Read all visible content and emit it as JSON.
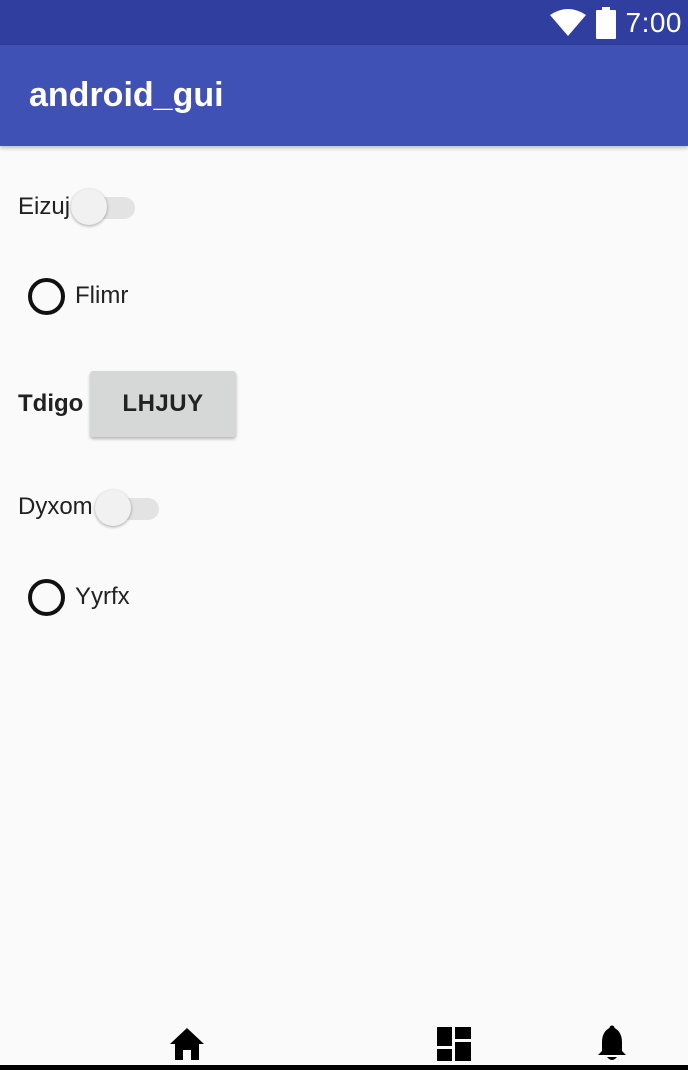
{
  "status_bar": {
    "time": "7:00",
    "icons": [
      "wifi-icon",
      "battery-icon"
    ],
    "background": "#303f9f"
  },
  "app_bar": {
    "title": "android_gui",
    "background": "#3f51b5"
  },
  "form": {
    "switch_1": {
      "label": "Eizuj",
      "checked": false
    },
    "radio_1": {
      "label": "Flimr",
      "checked": false
    },
    "button_row": {
      "label": "Tdigo",
      "button_label": "LHJUY"
    },
    "switch_2": {
      "label": "Dyxom",
      "checked": false
    },
    "radio_2": {
      "label": "Yyrfx",
      "checked": false
    }
  },
  "bottom_nav": {
    "items": [
      "home-icon",
      "dashboard-icon",
      "notifications-icon"
    ]
  },
  "colors": {
    "background": "#fafafa",
    "text": "#212121",
    "button": "#d6d7d7"
  }
}
